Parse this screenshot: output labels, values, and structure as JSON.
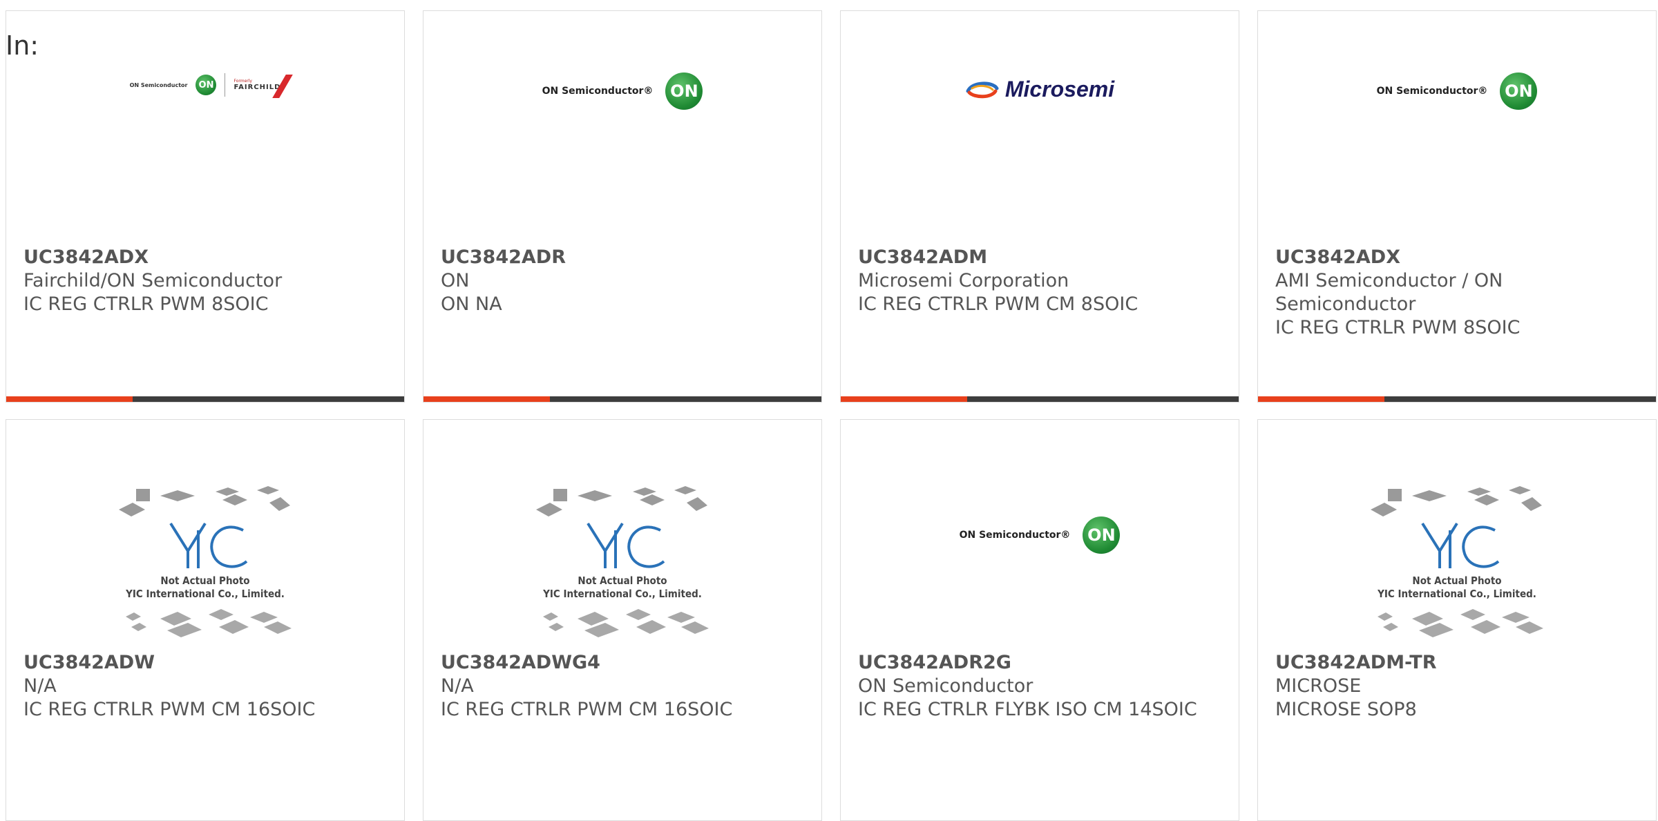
{
  "heading": "In:",
  "cards": [
    {
      "part": "UC3842ADX",
      "mfr": "Fairchild/ON Semiconductor",
      "desc": "IC REG CTRLR PWM 8SOIC",
      "logo": "fairchild-on-logo",
      "logo_text": {
        "on": "ON Semiconductor",
        "on_mark": "ON",
        "fair_top": "Formerly",
        "fair_name": "FAIRCHILD"
      }
    },
    {
      "part": "UC3842ADR",
      "mfr": "ON",
      "desc": "ON NA",
      "logo": "on-semiconductor-logo",
      "logo_text": {
        "on": "ON Semiconductor®",
        "on_mark": "ON"
      }
    },
    {
      "part": "UC3842ADM",
      "mfr": "Microsemi Corporation",
      "desc": "IC REG CTRLR PWM CM 8SOIC",
      "logo": "microsemi-logo",
      "logo_text": {
        "name": "Microsemi"
      }
    },
    {
      "part": "UC3842ADX",
      "mfr": "AMI Semiconductor / ON Semiconductor",
      "desc": "IC REG CTRLR PWM 8SOIC",
      "logo": "on-semiconductor-logo",
      "logo_text": {
        "on": "ON Semiconductor®",
        "on_mark": "ON"
      }
    },
    {
      "part": "UC3842ADW",
      "mfr": "N/A",
      "desc": "IC REG CTRLR PWM CM 16SOIC",
      "logo": "yic-placeholder",
      "logo_text": {
        "line1": "Not Actual Photo",
        "line2": "YIC International Co., Limited."
      }
    },
    {
      "part": "UC3842ADWG4",
      "mfr": "N/A",
      "desc": "IC REG CTRLR PWM CM 16SOIC",
      "logo": "yic-placeholder",
      "logo_text": {
        "line1": "Not Actual Photo",
        "line2": "YIC International Co., Limited."
      }
    },
    {
      "part": "UC3842ADR2G",
      "mfr": "ON Semiconductor",
      "desc": "IC REG CTRLR FLYBK ISO CM 14SOIC",
      "logo": "on-semiconductor-logo",
      "logo_text": {
        "on": "ON Semiconductor®",
        "on_mark": "ON"
      }
    },
    {
      "part": "UC3842ADM-TR",
      "mfr": "MICROSE",
      "desc": "MICROSE SOP8",
      "logo": "yic-placeholder",
      "logo_text": {
        "line1": "Not Actual Photo",
        "line2": "YIC International Co., Limited."
      }
    }
  ],
  "colors": {
    "accent": "#e8401c",
    "bar": "#3d3d3d",
    "on_green": "#1f8a33",
    "text": "#555555",
    "yic_blue": "#2a72b8"
  }
}
